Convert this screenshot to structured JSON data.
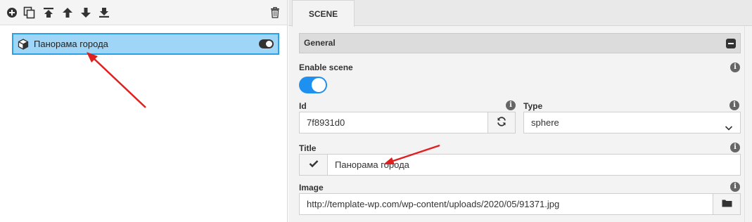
{
  "toolbar": {
    "icons": [
      "add-icon",
      "duplicate-icon",
      "move-top-icon",
      "move-up-icon",
      "move-down-icon",
      "move-bottom-icon",
      "trash-icon"
    ]
  },
  "scenes": [
    {
      "label": "Панорама города",
      "enabled": true
    }
  ],
  "tabs": [
    {
      "label": "SCENE"
    }
  ],
  "general": {
    "title": "General",
    "enable_scene": {
      "label": "Enable scene",
      "value": true
    },
    "id": {
      "label": "Id",
      "value": "7f8931d0"
    },
    "type": {
      "label": "Type",
      "value": "sphere"
    },
    "title_field": {
      "label": "Title",
      "value": "Панорама города"
    },
    "image": {
      "label": "Image",
      "value": "http://template-wp.com/wp-content/uploads/2020/05/91371.jpg"
    }
  },
  "colors": {
    "accent": "#1e90f0",
    "selection": "#9fd6f7",
    "selection_border": "#29a1e6",
    "annotation": "#e0201e"
  }
}
